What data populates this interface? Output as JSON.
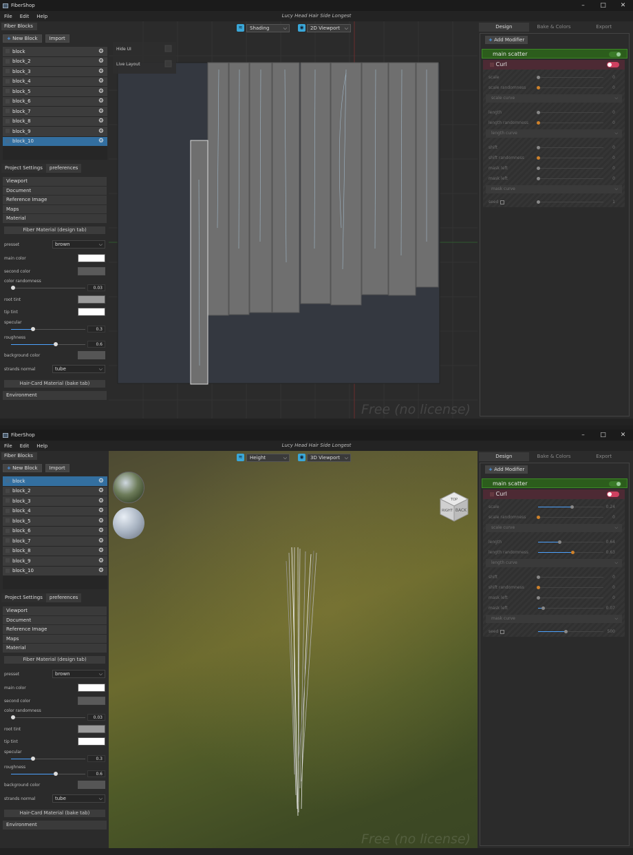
{
  "app": {
    "name": "FiberShop",
    "doc_title": "Lucy Head Hair Side Longest",
    "window_controls": {
      "minimize": "–",
      "maximize": "□",
      "close": "✕"
    }
  },
  "menu": [
    "File",
    "Edit",
    "Help"
  ],
  "left": {
    "panel_title": "Fiber Blocks",
    "new_block": "New Block",
    "import": "Import",
    "blocks": [
      "block",
      "block_2",
      "block_3",
      "block_4",
      "block_5",
      "block_6",
      "block_7",
      "block_8",
      "block_9",
      "block_10"
    ],
    "settings_tabs": [
      "Project Settings",
      "preferences"
    ],
    "sections": [
      "Viewport",
      "Document",
      "Reference Image",
      "Maps",
      "Material"
    ],
    "fiber_material_header": "Fiber Material (design tab)",
    "presset_label": "presset",
    "presset_value": "brown",
    "main_color_label": "main color",
    "main_color": "#ffffff",
    "second_color_label": "second color",
    "second_color": "#5a5a5a",
    "color_randomness_label": "color randomness",
    "color_randomness": "0.03",
    "root_tint_label": "root tint",
    "root_tint": "#9a9a9a",
    "tip_tint_label": "tip tint",
    "tip_tint": "#ffffff",
    "specular_label": "specular",
    "specular": "0.3",
    "roughness_label": "roughness",
    "roughness": "0.6",
    "background_color_label": "background color",
    "background_color": "#555555",
    "strands_normal_label": "strands normal",
    "strands_normal_value": "tube",
    "haircard_header": "Hair-Card Material (bake tab)",
    "environment": "Environment"
  },
  "right": {
    "tabs": [
      "Design",
      "Bake & Colors",
      "Export"
    ],
    "add_modifier": "Add Modifier",
    "modifiers": [
      {
        "name": "main scatter"
      },
      {
        "name": "Curl"
      }
    ],
    "curve_labels": {
      "scale": "scale curve",
      "length": "length curve",
      "mask": "mask curve"
    }
  },
  "screens": [
    {
      "shading_mode": "Shading",
      "viewport_mode": "2D Viewport",
      "overlay": {
        "hide_ui": "Hide UI",
        "live_layout": "Live Layout"
      },
      "selected_block": "block_10",
      "watermark": "Free (no license)",
      "params": [
        {
          "label": "scale",
          "value": "0",
          "level": 0.0,
          "color": "grey"
        },
        {
          "label": "scale randomness",
          "value": "0",
          "level": 0.0,
          "color": "orange"
        },
        {
          "label": "length",
          "value": "0",
          "level": 0.0,
          "color": "grey"
        },
        {
          "label": "length randomness",
          "value": "0",
          "level": 0.0,
          "color": "orange"
        },
        {
          "label": "shift",
          "value": "0",
          "level": 0.0,
          "color": "grey"
        },
        {
          "label": "shift randomness",
          "value": "0",
          "level": 0.0,
          "color": "orange"
        },
        {
          "label": "mask left",
          "value": "0",
          "level": 0.0,
          "color": "grey"
        },
        {
          "label": "mask left",
          "value": "0",
          "level": 0.0,
          "color": "grey"
        },
        {
          "label": "seed",
          "value": "1",
          "level": 0.0,
          "color": "grey"
        }
      ]
    },
    {
      "shading_mode": "Height",
      "viewport_mode": "3D Viewport",
      "selected_block": "block",
      "watermark": "Free (no license)",
      "navcube": {
        "top": "TOP",
        "right": "RIGHT",
        "back": "BACK"
      },
      "params": [
        {
          "label": "scale",
          "value": "0.24",
          "level": 0.52,
          "color": "grey"
        },
        {
          "label": "scale randomness",
          "value": "0",
          "level": 0.0,
          "color": "orange"
        },
        {
          "label": "length",
          "value": "0.64",
          "level": 0.33,
          "color": "grey"
        },
        {
          "label": "length randomness",
          "value": "0.63",
          "level": 0.53,
          "color": "orange"
        },
        {
          "label": "shift",
          "value": "0",
          "level": 0.0,
          "color": "grey"
        },
        {
          "label": "shift randomness",
          "value": "0",
          "level": 0.0,
          "color": "orange"
        },
        {
          "label": "mask left",
          "value": "0",
          "level": 0.0,
          "color": "grey"
        },
        {
          "label": "mask left",
          "value": "0.07",
          "level": 0.07,
          "color": "grey"
        },
        {
          "label": "seed",
          "value": "500",
          "level": 0.42,
          "color": "grey"
        }
      ]
    }
  ]
}
